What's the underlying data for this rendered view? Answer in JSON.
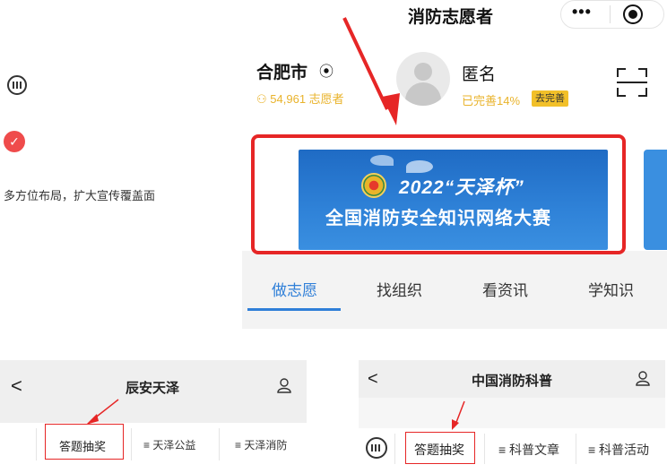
{
  "left_note": {
    "check_icon": "check-circle-icon",
    "caption": "多方位布局，扩大宣传覆盖面"
  },
  "top_phone": {
    "app_title": "消防志愿者",
    "capsule": {
      "more": "•••",
      "close_icon": "target-icon"
    },
    "city": "合肥市",
    "location_icon": "location-pin-icon",
    "volunteer_count": "54,961 志愿者",
    "user": {
      "name": "匿名",
      "progress_text": "已完善14%",
      "complete_badge": "去完善"
    },
    "banner": {
      "line1": "2022“天泽杯”",
      "line2": "全国消防安全知识网络大赛"
    },
    "tabs": [
      "做志愿",
      "找组织",
      "看资讯",
      "学知识"
    ],
    "active_tab_color": "#2f7fd8"
  },
  "bottom_left_phone": {
    "back": "<",
    "title": "辰安天泽",
    "menu": [
      "答题抽奖",
      "≡ 天泽公益",
      "≡ 天泽消防"
    ]
  },
  "bottom_right_phone": {
    "back": "<",
    "title": "中国消防科普",
    "menu": [
      "答题抽奖",
      "≡ 科普文章",
      "≡ 科普活动"
    ]
  },
  "accent_red": "#e62626",
  "accent_yellow": "#e9b32b"
}
